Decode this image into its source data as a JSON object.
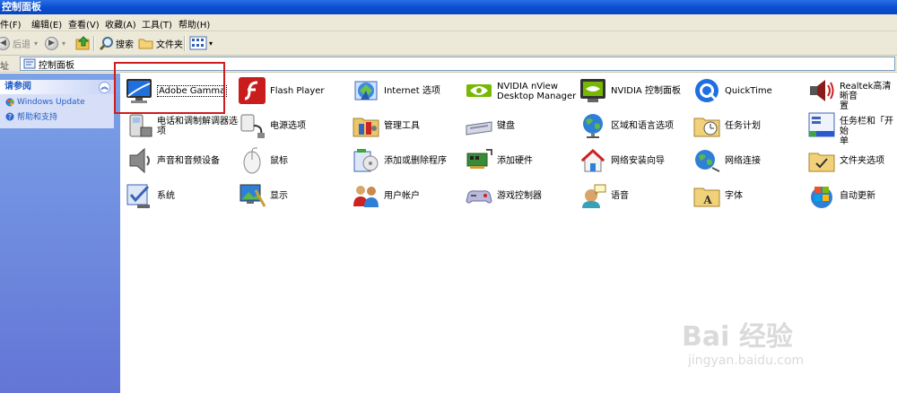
{
  "window": {
    "title": "控制面板"
  },
  "menu": [
    "件(F)",
    "编辑(E)",
    "查看(V)",
    "收藏(A)",
    "工具(T)",
    "帮助(H)"
  ],
  "toolbar": {
    "back": "后退",
    "search": "搜索",
    "folders": "文件夹"
  },
  "address": {
    "label": "址",
    "value": "控制面板"
  },
  "sidebar": {
    "section_title": "请参阅",
    "links": [
      "Windows Update",
      "帮助和支持"
    ]
  },
  "items": [
    {
      "label": "Adobe Gamma",
      "icon": "monitor-icon"
    },
    {
      "label": "Flash Player",
      "icon": "flash-icon"
    },
    {
      "label": "Internet 选项",
      "icon": "internet-icon"
    },
    {
      "label": "NVIDIA nView\nDesktop Manager",
      "icon": "nvidia-icon"
    },
    {
      "label": "NVIDIA 控制面板",
      "icon": "nvidia-panel-icon"
    },
    {
      "label": "QuickTime",
      "icon": "quicktime-icon"
    },
    {
      "label": "Realtek高清晰音\n置",
      "icon": "speaker-icon"
    },
    {
      "label": "电话和调制解调器选\n项",
      "icon": "phone-icon"
    },
    {
      "label": "电源选项",
      "icon": "power-icon"
    },
    {
      "label": "管理工具",
      "icon": "admin-tools-icon"
    },
    {
      "label": "键盘",
      "icon": "keyboard-icon"
    },
    {
      "label": "区域和语言选项",
      "icon": "globe-icon"
    },
    {
      "label": "任务计划",
      "icon": "scheduled-tasks-icon"
    },
    {
      "label": "任务栏和「开始\n单",
      "icon": "taskbar-icon"
    },
    {
      "label": "声音和音频设备",
      "icon": "sound-icon"
    },
    {
      "label": "鼠标",
      "icon": "mouse-icon"
    },
    {
      "label": "添加或删除程序",
      "icon": "add-remove-icon"
    },
    {
      "label": "添加硬件",
      "icon": "hardware-icon"
    },
    {
      "label": "网络安装向导",
      "icon": "network-setup-icon"
    },
    {
      "label": "网络连接",
      "icon": "network-icon"
    },
    {
      "label": "文件夹选项",
      "icon": "folder-options-icon"
    },
    {
      "label": "系统",
      "icon": "system-icon"
    },
    {
      "label": "显示",
      "icon": "display-icon"
    },
    {
      "label": "用户帐户",
      "icon": "users-icon"
    },
    {
      "label": "游戏控制器",
      "icon": "gamepad-icon"
    },
    {
      "label": "语音",
      "icon": "speech-icon"
    },
    {
      "label": "字体",
      "icon": "fonts-icon"
    },
    {
      "label": "自动更新",
      "icon": "windows-update-icon"
    }
  ],
  "watermark": {
    "brand": "Bai 经验",
    "url": "jingyan.baidu.com"
  }
}
